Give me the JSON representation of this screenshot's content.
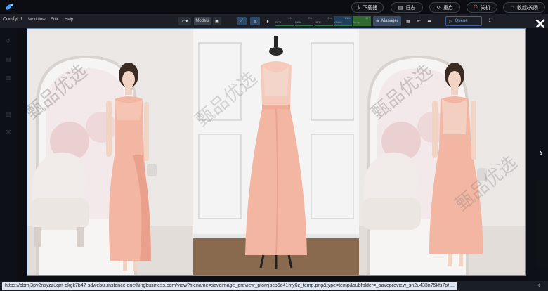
{
  "topbar": {
    "download_label": "下载器",
    "log_label": "日志",
    "restart_label": "重启",
    "shutdown_label": "关机",
    "collapse_label": "收起/关闭",
    "download_icon": "download-icon",
    "log_icon": "log-icon",
    "restart_icon": "restart-icon",
    "shutdown_icon": "power-icon",
    "collapse_icon": "chevron-up-icon"
  },
  "menubar": {
    "brand": "ComfyUI",
    "items": [
      "Workflow",
      "Edit",
      "Help"
    ],
    "models_label": "Models",
    "gauges": [
      {
        "label": "CPU",
        "value": "0%"
      },
      {
        "label": "RAM",
        "value": "9%"
      },
      {
        "label": "GPU",
        "value": "0%"
      },
      {
        "label": "VRAM",
        "value": "61%"
      },
      {
        "label": "Temp",
        "value": "36°"
      }
    ],
    "manager_label": "Manager",
    "queue_label": "Queue",
    "queue_count": "1"
  },
  "lightbox": {
    "panels": [
      "left-model-photo",
      "center-mannequin-photo",
      "right-model-photo"
    ],
    "watermark_text": "甄品优选",
    "close_icon": "close-icon",
    "next_icon": "chevron-right-icon"
  },
  "statusbar": {
    "url": "https://bbmj3pv2nsyzzuqm-qkgk7b47-sdwebui.instance.onethingbusiness.com/view?filename=saveimage_preview_ptomjbcp5e41my6z_temp.png&type=temp&subfolder=_savepreview_sn2u433n75kfs7pf ..."
  },
  "colors": {
    "accent": "#3e5f9a",
    "frame_border": "#6a8bb8",
    "dress_pink": "#f3b6a3"
  }
}
